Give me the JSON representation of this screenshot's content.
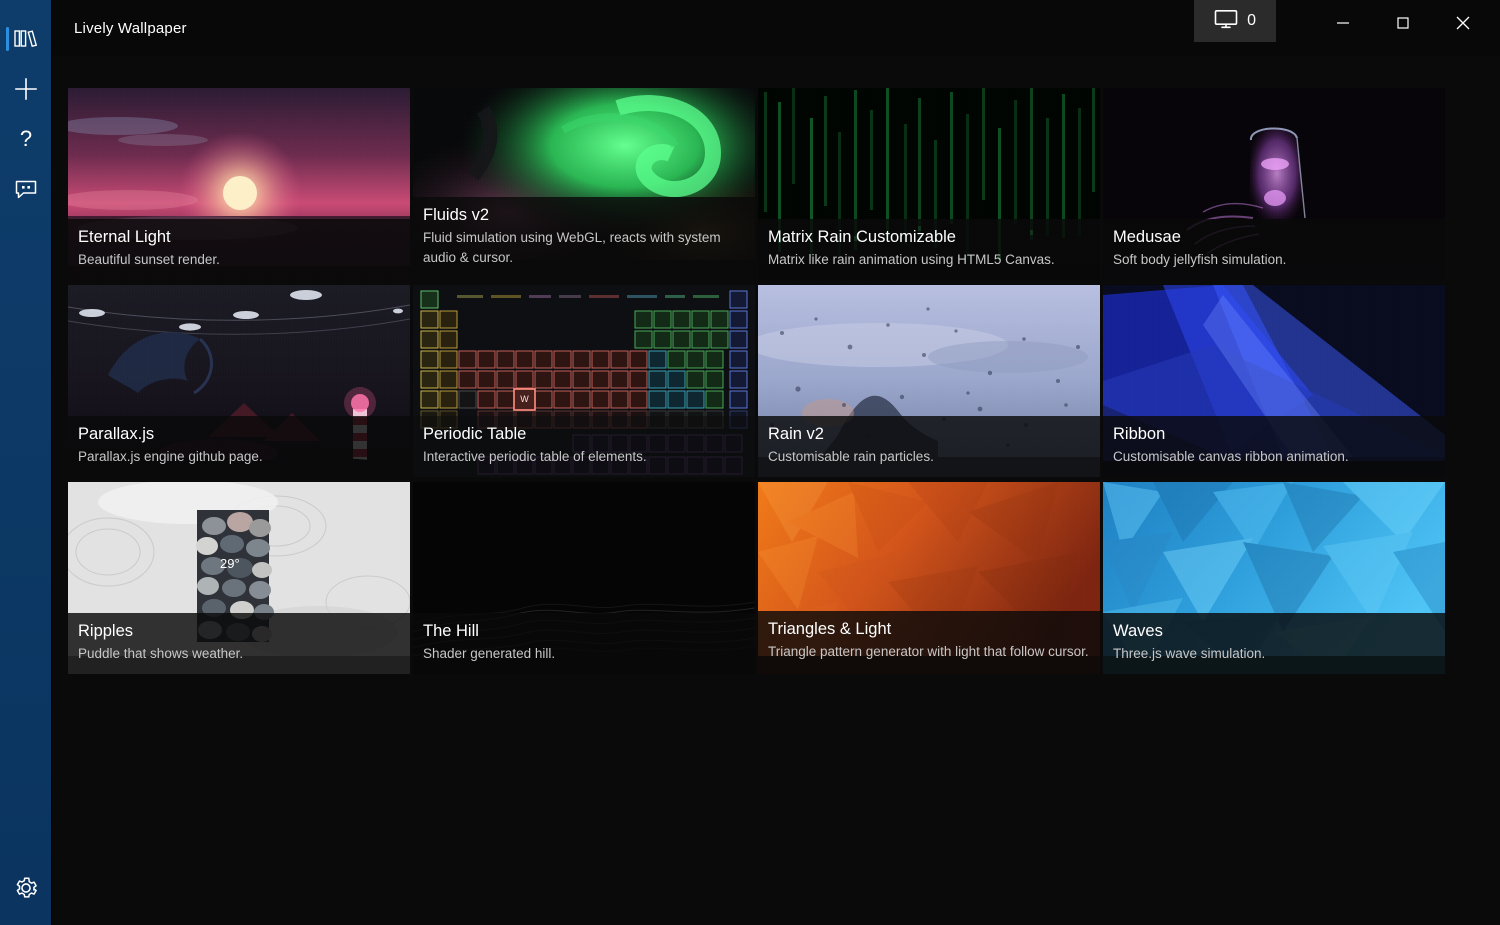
{
  "window": {
    "title": "Lively Wallpaper",
    "screen_count": "0",
    "screen_icon": "monitor-icon",
    "minimize_label": "—",
    "maximize_label": "□",
    "close_label": "✕"
  },
  "sidebar": {
    "items": [
      {
        "name": "library",
        "icon": "library-books-icon",
        "active": true
      },
      {
        "name": "add",
        "icon": "plus-icon",
        "active": false
      },
      {
        "name": "help",
        "icon": "question-mark-icon",
        "active": false
      },
      {
        "name": "feedback",
        "icon": "chat-bubble-icon",
        "active": false
      }
    ],
    "bottom": {
      "name": "settings",
      "icon": "gear-icon"
    }
  },
  "library": {
    "wallpapers": [
      {
        "title": "Eternal Light",
        "description": "Beautiful sunset render.",
        "thumb": "sunset-ocean",
        "accent": "#d4547e"
      },
      {
        "title": "Fluids v2",
        "description": "Fluid simulation using WebGL, reacts with system audio & cursor.",
        "thumb": "green-fluid-swirl",
        "accent": "#38e06a"
      },
      {
        "title": "Matrix Rain Customizable",
        "description": "Matrix like rain animation using HTML5 Canvas.",
        "thumb": "matrix-rain",
        "accent": "#1faa4a"
      },
      {
        "title": "Medusae",
        "description": "Soft body jellyfish simulation.",
        "thumb": "purple-jellyfish",
        "accent": "#c261d6"
      },
      {
        "title": "Parallax.js",
        "description": "Parallax.js engine github page.",
        "thumb": "night-wave-lighthouse",
        "accent": "#b2384f"
      },
      {
        "title": "Periodic Table",
        "description": "Interactive periodic table of elements.",
        "thumb": "periodic-table",
        "accent": "#d8a13a"
      },
      {
        "title": "Rain v2",
        "description": "Customisable rain particles.",
        "thumb": "rainy-window",
        "accent": "#a9b5d8"
      },
      {
        "title": "Ribbon",
        "description": "Customisable canvas ribbon animation.",
        "thumb": "blue-ribbon",
        "accent": "#2340d8"
      },
      {
        "title": "Ripples",
        "description": "Puddle that shows weather.",
        "thumb": "puddle-pebbles",
        "accent": "#d7d7d7",
        "temperature": "29°"
      },
      {
        "title": "The Hill",
        "description": "Shader generated hill.",
        "thumb": "dark-hill-shader",
        "accent": "#2a2a2a"
      },
      {
        "title": "Triangles & Light",
        "description": "Triangle pattern generator with light that follow cursor.",
        "thumb": "orange-triangles",
        "accent": "#e2621c"
      },
      {
        "title": "Waves",
        "description": "Three.js wave simulation.",
        "thumb": "blue-triangles",
        "accent": "#2a9fe0"
      }
    ]
  },
  "colors": {
    "sidebar": "#0d3a66",
    "sidebar_active": "#2a8fe0",
    "titlebar": "#080808",
    "content_bg": "#0a0a0a",
    "caption_bg": "rgba(10,10,10,0.82)",
    "title_text": "#ffffff",
    "desc_text": "#c7c7c7"
  }
}
